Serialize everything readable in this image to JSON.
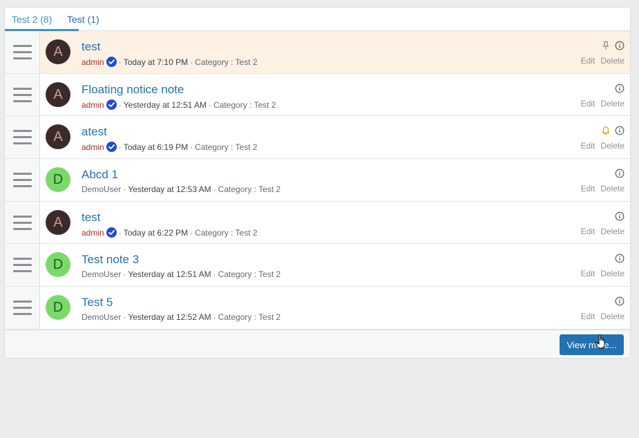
{
  "tabs": [
    {
      "label": "Test 2 (8)",
      "active": true
    },
    {
      "label": "Test (1)",
      "active": false
    }
  ],
  "notes": [
    {
      "title": "test",
      "author": "admin",
      "author_role": "admin",
      "verified": true,
      "when": "Today at 7:10 PM",
      "category": "Category : Test 2",
      "avatar_letter": "A",
      "pinned": true,
      "reminder": false,
      "highlight": true
    },
    {
      "title": "Floating notice note",
      "author": "admin",
      "author_role": "admin",
      "verified": true,
      "when": "Yesterday at 12:51 AM",
      "category": "Category : Test 2",
      "avatar_letter": "A",
      "pinned": false,
      "reminder": false,
      "highlight": false
    },
    {
      "title": "atest",
      "author": "admin",
      "author_role": "admin",
      "verified": true,
      "when": "Today at 6:19 PM",
      "category": "Category : Test 2",
      "avatar_letter": "A",
      "pinned": false,
      "reminder": true,
      "highlight": false
    },
    {
      "title": "Abcd 1",
      "author": "DemoUser",
      "author_role": "demo",
      "verified": false,
      "when": "Yesterday at 12:53 AM",
      "category": "Category : Test 2",
      "avatar_letter": "D",
      "pinned": false,
      "reminder": false,
      "highlight": false
    },
    {
      "title": "test",
      "author": "admin",
      "author_role": "admin",
      "verified": true,
      "when": "Today at 6:22 PM",
      "category": "Category : Test 2",
      "avatar_letter": "A",
      "pinned": false,
      "reminder": false,
      "highlight": false
    },
    {
      "title": "Test note 3",
      "author": "DemoUser",
      "author_role": "demo",
      "verified": false,
      "when": "Yesterday at 12:51 AM",
      "category": "Category : Test 2",
      "avatar_letter": "D",
      "pinned": false,
      "reminder": false,
      "highlight": false
    },
    {
      "title": "Test 5",
      "author": "DemoUser",
      "author_role": "demo",
      "verified": false,
      "when": "Yesterday at 12:52 AM",
      "category": "Category : Test 2",
      "avatar_letter": "D",
      "pinned": false,
      "reminder": false,
      "highlight": false
    }
  ],
  "actions": {
    "edit_label": "Edit",
    "delete_label": "Delete"
  },
  "separator": "·",
  "footer": {
    "view_more_label": "View more..."
  },
  "colors": {
    "accent": "#2271b1",
    "admin": "#b32d2e",
    "highlight_row": "#fdf1e3",
    "reminder": "#dba617"
  }
}
